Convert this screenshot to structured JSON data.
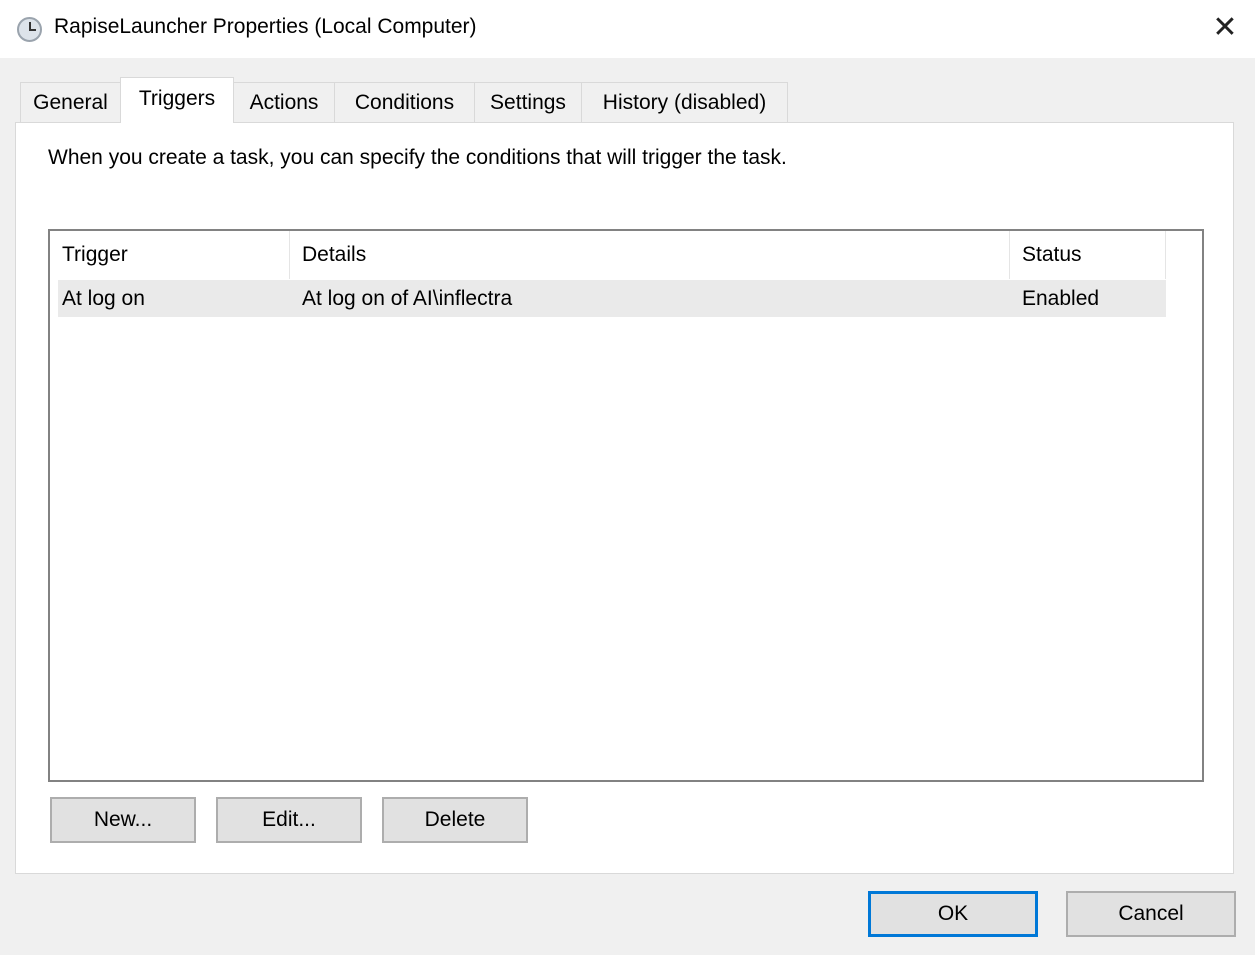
{
  "window": {
    "title": "RapiseLauncher Properties (Local Computer)",
    "close": "✕"
  },
  "tabs": [
    {
      "label": "General"
    },
    {
      "label": "Triggers"
    },
    {
      "label": "Actions"
    },
    {
      "label": "Conditions"
    },
    {
      "label": "Settings"
    },
    {
      "label": "History (disabled)"
    }
  ],
  "selected_tab": "Triggers",
  "description": "When you create a task, you can specify the conditions that will trigger the task.",
  "table": {
    "columns": [
      "Trigger",
      "Details",
      "Status"
    ],
    "rows": [
      {
        "trigger": "At log on",
        "details": "At log on of AI\\inflectra",
        "status": "Enabled"
      }
    ]
  },
  "buttons": {
    "new": "New...",
    "edit": "Edit...",
    "delete": "Delete",
    "ok": "OK",
    "cancel": "Cancel"
  },
  "colors": {
    "default_button_border": "#0078d7"
  }
}
